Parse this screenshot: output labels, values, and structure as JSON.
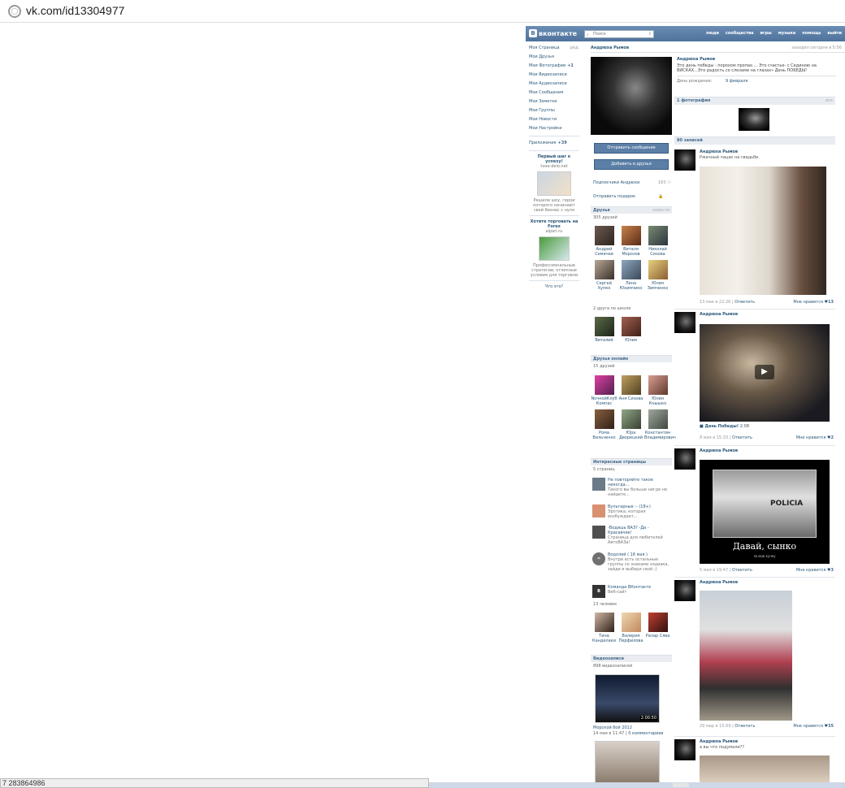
{
  "browser": {
    "url": "vk.com/id13304977",
    "status_text": "7 283864986"
  },
  "topbar": {
    "logo": "вконтакте",
    "search_placeholder": "Поиск",
    "nav": [
      "люди",
      "сообщества",
      "игры",
      "музыка",
      "помощь",
      "выйти"
    ]
  },
  "left_menu": {
    "items": [
      {
        "label": "Моя Страница",
        "extra": "ред."
      },
      {
        "label": "Мои Друзья",
        "extra": ""
      },
      {
        "label": "Мои Фотографии",
        "extra": "+1"
      },
      {
        "label": "Мои Видеозаписи",
        "extra": ""
      },
      {
        "label": "Мои Аудиозаписи",
        "extra": ""
      },
      {
        "label": "Мои Сообщения",
        "extra": ""
      },
      {
        "label": "Мои Заметки",
        "extra": ""
      },
      {
        "label": "Мои Группы",
        "extra": ""
      },
      {
        "label": "Мои Новости",
        "extra": ""
      },
      {
        "label": "Мои Настройки",
        "extra": ""
      }
    ],
    "apps": {
      "label": "Приложения",
      "extra": "+39"
    },
    "ad1": {
      "title": "Первый шаг к успеху!",
      "site": "tvoe-delo.net",
      "desc": "Решили шоу, герои которого начинают свой бизнес с нуля"
    },
    "ad2": {
      "title": "Хотите торговать на Forex",
      "site": "alpari.ru",
      "desc": "Профессиональные стратегии, отличные условия для торговли"
    },
    "what": "Что это?"
  },
  "profile": {
    "name": "Андрюха Рымов",
    "online": "заходил сегодня в 5:56",
    "status": "Это день победы - порохом пропах.... Это счастье- с Сединою на ВИСКАХ...Это радость со слезами на глазах» День ПОБЕДЫ!",
    "bday_label": "День рождения:",
    "bday_value": "9 февраля",
    "send_message": "Отправить сообщение",
    "add_friend": "Добавить в друзья",
    "followers": "Подписчики Андрюхи",
    "followers_count": "183",
    "gift": "Отправить подарок"
  },
  "friends": {
    "title": "Друзья",
    "link": "новости",
    "count": "305 друзей",
    "items": [
      {
        "name": "Андрей Семичев"
      },
      {
        "name": "Виталя Морозов"
      },
      {
        "name": "Николай Сизова"
      },
      {
        "name": "Сергей Хупко"
      },
      {
        "name": "Лена Юхимчико"
      },
      {
        "name": "Юлия Зимченко"
      }
    ],
    "school_count": "2 друга по школе",
    "school": [
      {
        "name": "Виталий"
      },
      {
        "name": "Юлия"
      }
    ]
  },
  "online": {
    "title": "Друзья онлайн",
    "count": "15 друзей",
    "items": [
      {
        "name": "NoчнойКлуб Компас"
      },
      {
        "name": "Аня Сизова"
      },
      {
        "name": "Юлия Кнышко"
      },
      {
        "name": "Рома Вильченко"
      },
      {
        "name": "Юра Дворецкий"
      },
      {
        "name": "Константин Владимирович"
      }
    ]
  },
  "pages": {
    "title": "Интересные страницы",
    "count": "5 страниц",
    "items": [
      {
        "name": "Не повторяйте такое никогда...",
        "desc": "Такого вы больше нигде не найдете..."
      },
      {
        "name": "Вульгарные :- (18+)",
        "desc": "Эротика, которая возбуждает..."
      },
      {
        "name": "-Водишь ВАЗ? -Да - Красавчик!",
        "desc": "Страница для любителей АвтоВАЗа!"
      },
      {
        "name": "Водолей ( 16 мая )",
        "desc": "Внутри есть остальные группы со знаками зодиака, зайди и выбери свой ;)"
      },
      {
        "name": "Команда ВКонтакте",
        "desc": "Веб-сайт"
      }
    ],
    "people_count": "13 человек",
    "people": [
      {
        "name": "Тина Канделаки"
      },
      {
        "name": "Валерия Перфилова"
      },
      {
        "name": "Ралар Сява"
      }
    ]
  },
  "videos": {
    "title": "Видеозаписи",
    "count": "898 видеозаписей",
    "v1_time": "2:00:50",
    "v1_title": "Морской бой 2012",
    "v1_date": "14 мая в 11:47",
    "v1_comments": "0 комментариев"
  },
  "photos": {
    "title": "1 фотография",
    "link": "все"
  },
  "wall": {
    "title": "80 записей",
    "posts": [
      {
        "name": "Андрюха Рымов",
        "text": "Ржачный пацак на свадьбе.",
        "date": "13 мая в 22:26",
        "reply": "Ответить",
        "likes_label": "Мне нравится",
        "likes": "13"
      },
      {
        "name": "Андрюха Рымов",
        "text": "",
        "video_title": "День Победы!",
        "video_len": "2:08",
        "date": "8 мая в 15:33",
        "reply": "Ответить",
        "likes_label": "Мне нравится",
        "likes": "2"
      },
      {
        "name": "Андрюха Рымов",
        "text": "",
        "caption": "Давай, сынко",
        "caption_sub": "за всю кучку",
        "van_text": "POLICIA",
        "date": "5 мая в 19:47",
        "reply": "Ответить",
        "likes_label": "Мне нравится",
        "likes": "3"
      },
      {
        "name": "Андрюха Рымов",
        "text": "",
        "date": "29 мар в 15:09",
        "reply": "Ответить",
        "likes_label": "Мне нравится",
        "likes": "35"
      },
      {
        "name": "Андрюха Рымов",
        "text": "а вы что подумали??"
      }
    ]
  }
}
